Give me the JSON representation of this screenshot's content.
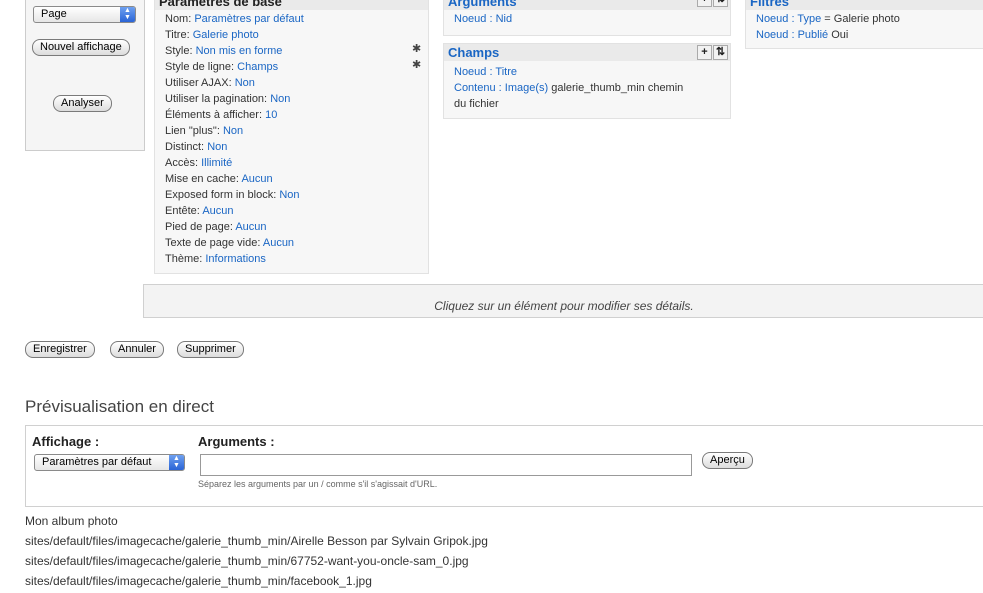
{
  "left_panel": {
    "display_select": "Page",
    "new_display_button": "Nouvel affichage",
    "analyze_button": "Analyser"
  },
  "basic_settings": {
    "title": "Paramètres de base",
    "rows": [
      {
        "label": "Nom:",
        "value": "Paramètres par défaut"
      },
      {
        "label": "Titre:",
        "value": "Galerie photo"
      },
      {
        "label": "Style:",
        "value": "Non mis en forme"
      },
      {
        "label": "Style de ligne:",
        "value": "Champs"
      },
      {
        "label": "Utiliser AJAX:",
        "value": "Non"
      },
      {
        "label": "Utiliser la pagination:",
        "value": "Non"
      },
      {
        "label": "Éléments à afficher:",
        "value": "10"
      },
      {
        "label": "Lien \"plus\":",
        "value": "Non"
      },
      {
        "label": "Distinct:",
        "value": "Non"
      },
      {
        "label": "Accès:",
        "value": "Illimité"
      },
      {
        "label": "Mise en cache:",
        "value": "Aucun"
      },
      {
        "label": "Exposed form in block:",
        "value": "Non"
      },
      {
        "label": "Entête:",
        "value": "Aucun"
      },
      {
        "label": "Pied de page:",
        "value": "Aucun"
      },
      {
        "label": "Texte de page vide:",
        "value": "Aucun"
      },
      {
        "label": "Thème:",
        "value": "Informations"
      }
    ]
  },
  "arguments": {
    "title": "Arguments",
    "items": [
      {
        "link": "Noeud : Nid",
        "text": ""
      }
    ]
  },
  "fields": {
    "title": "Champs",
    "items": [
      {
        "link": "Noeud : Titre",
        "text": ""
      },
      {
        "link": "Contenu : Image(s)",
        "text": " galerie_thumb_min chemin",
        "text2": "du fichier"
      }
    ]
  },
  "filters": {
    "title": "Filtres",
    "items": [
      {
        "link": "Noeud : Type",
        "text": " = Galerie photo"
      },
      {
        "link": "Noeud : Publié",
        "text": " Oui"
      }
    ]
  },
  "footer_hint": "Cliquez sur un élément pour modifier ses détails.",
  "actions": {
    "save": "Enregistrer",
    "cancel": "Annuler",
    "delete": "Supprimer"
  },
  "preview": {
    "heading": "Prévisualisation en direct",
    "display_label": "Affichage :",
    "display_value": "Paramètres par défaut",
    "arguments_label": "Arguments :",
    "arguments_value": "",
    "arguments_hint": "Séparez les arguments par un / comme s'il s'agissait d'URL.",
    "preview_button": "Aperçu"
  },
  "output": [
    "Mon album photo",
    "sites/default/files/imagecache/galerie_thumb_min/Airelle Besson par Sylvain Gripok.jpg",
    "sites/default/files/imagecache/galerie_thumb_min/67752-want-you-oncle-sam_0.jpg",
    "sites/default/files/imagecache/galerie_thumb_min/facebook_1.jpg"
  ]
}
